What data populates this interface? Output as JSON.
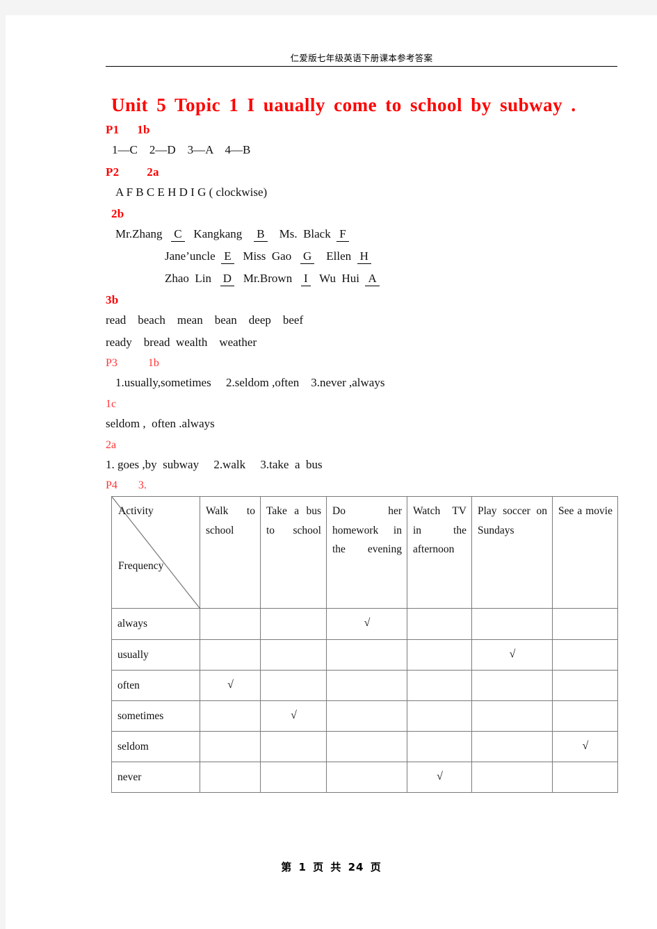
{
  "header": {
    "running_title": "仁爱版七年级英语下册课本参考答案"
  },
  "title": "Unit 5 Topic 1    I uaually  come  to  school  by  subway  .",
  "sections": {
    "p1": {
      "page_label": "P1",
      "item_label": "1b",
      "answer": "1—C    2—D    3—A    4—B"
    },
    "p2": {
      "page_label": "P2",
      "item_2a_label": "2a",
      "answer_2a": "A F B C E H D I G ( clockwise)",
      "item_2b_label": "2b",
      "matches_row1": [
        {
          "name": "Mr.Zhang",
          "answer": "C"
        },
        {
          "name": "Kangkang",
          "answer": "B"
        },
        {
          "name": "Ms.  Black",
          "answer": "F"
        }
      ],
      "matches_row2": [
        {
          "name": "Jane’uncle",
          "answer": "E"
        },
        {
          "name": "Miss  Gao",
          "answer": "G"
        },
        {
          "name": "Ellen",
          "answer": "H"
        }
      ],
      "matches_row3": [
        {
          "name": "Zhao  Lin",
          "answer": "D"
        },
        {
          "name": "Mr.Brown",
          "answer": "I"
        },
        {
          "name": "Wu  Hui",
          "answer": "A"
        }
      ],
      "item_3b_label": "3b",
      "words_line1": "read    beach    mean    bean    deep    beef",
      "words_line2": "ready    bread  wealth    weather"
    },
    "p3": {
      "page_label": "P3",
      "item_1b_label": "1b",
      "answer_1b": "1.usually,sometimes     2.seldom ,often    3.never ,always",
      "item_1c_label": "1c",
      "answer_1c": "seldom ,  often .always",
      "item_2a_label": "2a",
      "answer_2a": "1. goes ,by  subway     2.walk     3.take  a  bus"
    },
    "p4": {
      "page_label": "P4",
      "item_label": "3."
    }
  },
  "table": {
    "corner_top": "Activity",
    "corner_bottom": "Frequency",
    "columns": [
      "Walk  to  school",
      "Take  a  bus  to  school",
      "Do  her  homework  in  the  evening",
      "Watch  TV  in  the  afternoon",
      "Play  soccer  on Sundays",
      "See  a  movie"
    ],
    "rows": [
      {
        "label": "always",
        "marks": [
          false,
          false,
          true,
          false,
          false,
          false
        ]
      },
      {
        "label": "usually",
        "marks": [
          false,
          false,
          false,
          false,
          true,
          false
        ]
      },
      {
        "label": "often",
        "marks": [
          true,
          false,
          false,
          false,
          false,
          false
        ]
      },
      {
        "label": "sometimes",
        "marks": [
          false,
          true,
          false,
          false,
          false,
          false
        ]
      },
      {
        "label": "seldom",
        "marks": [
          false,
          false,
          false,
          false,
          false,
          true
        ]
      },
      {
        "label": "never",
        "marks": [
          false,
          false,
          false,
          true,
          false,
          false
        ]
      }
    ],
    "check_glyph": "√"
  },
  "footer": "第 1 页 共 24 页",
  "colors": {
    "accent_red": "#ff0000",
    "light_red": "#ff3333",
    "text": "#111111",
    "rule": "#000000",
    "table_border": "#7a7a7a"
  }
}
